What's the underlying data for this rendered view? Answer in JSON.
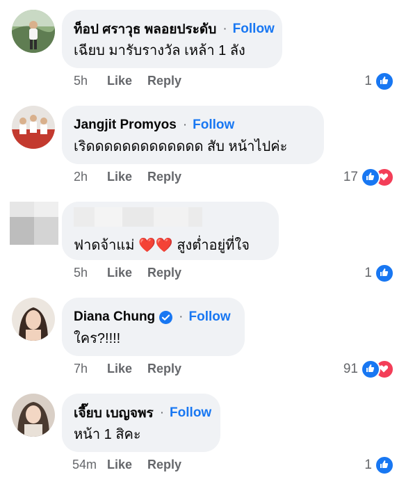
{
  "ui": {
    "dot": "·",
    "like_label": "Like",
    "reply_label": "Reply"
  },
  "colors": {
    "bubble": "#f0f2f5",
    "link_blue": "#1877f2",
    "meta_gray": "#65676b",
    "love_red": "#f33e58"
  },
  "comments": [
    {
      "author": "ท็อป ศราวุธ พลอยประดับ",
      "follow": "Follow",
      "text": "เฉียบ มารับรางวัล เหล้า 1 ลัง",
      "time": "5h",
      "reaction_count": "1",
      "reactions": [
        "like-icon"
      ]
    },
    {
      "author": "Jangjit Promyos",
      "follow": "Follow",
      "text": "เริดดดดดดดดดดดดด  สับ หน้าไปค่ะ",
      "time": "2h",
      "reaction_count": "17",
      "reactions": [
        "like-icon",
        "love-icon"
      ]
    },
    {
      "author": "",
      "follow": "",
      "text": "ฟาดจ้าแม่ ❤️❤️ สูงต่ำอยู่ที่ใจ",
      "time": "5h",
      "reaction_count": "1",
      "reactions": [
        "like-icon"
      ],
      "name_blurred": true
    },
    {
      "author": "Diana Chung",
      "verified": true,
      "follow": "Follow",
      "text": "ใคร?!!!!",
      "time": "7h",
      "reaction_count": "91",
      "reactions": [
        "like-icon",
        "love-icon"
      ]
    },
    {
      "author": "เจี๊ยบ เบญจพร",
      "follow": "Follow",
      "text": "หน้า 1 สิคะ",
      "time": "54m",
      "reaction_count": "1",
      "reactions": [
        "like-icon"
      ]
    }
  ]
}
